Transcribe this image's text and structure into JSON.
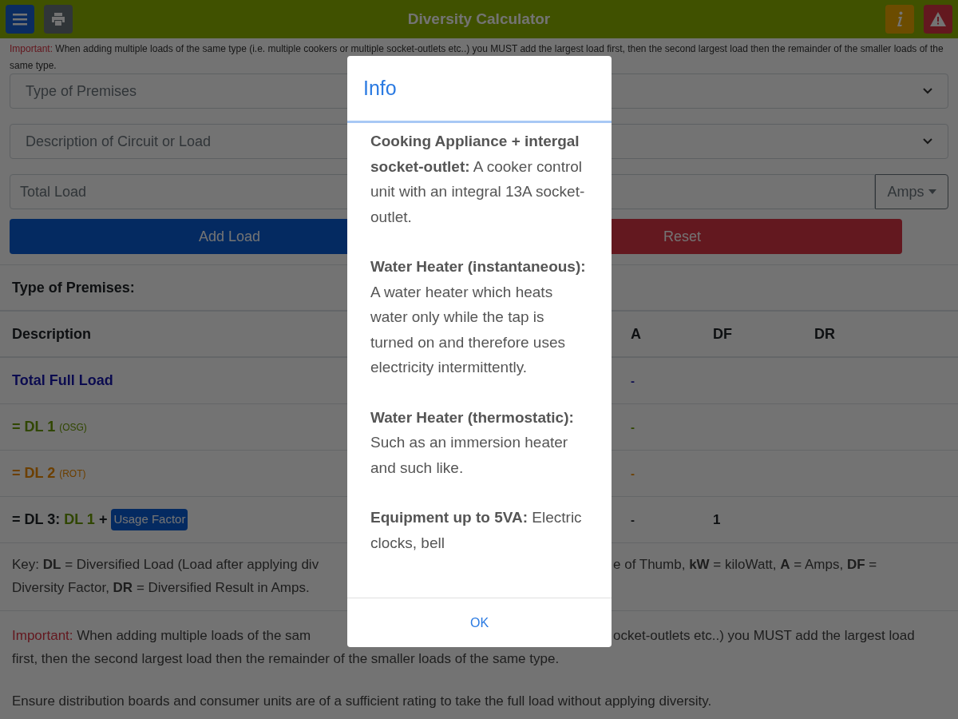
{
  "header": {
    "title": "Diversity Calculator"
  },
  "notice_top": {
    "label": "Important:",
    "text": "When adding multiple loads of the same type (i.e. multiple cookers or multiple socket-outlets etc..) you MUST add the largest load first, then the second largest load then the remainder of the smaller loads of the same type."
  },
  "form": {
    "premises_select": {
      "placeholder": "Type of Premises"
    },
    "load_select": {
      "placeholder": "Description of Circuit or Load"
    },
    "total_load": {
      "placeholder": "Total Load"
    },
    "unit_button": "Amps",
    "add_button": "Add Load",
    "reset_button": "Reset"
  },
  "summary": {
    "label": "Type of Premises:"
  },
  "table": {
    "columns": [
      "Description",
      "A",
      "DF",
      "DR"
    ],
    "rows": [
      {
        "kind": "total",
        "label": "Total Full Load",
        "a": "-"
      },
      {
        "kind": "dl1",
        "prefix": "=",
        "label": "DL 1",
        "note": "(OSG)",
        "a": "-"
      },
      {
        "kind": "dl2",
        "prefix": "=",
        "label": "DL 2",
        "note": "(ROT)",
        "a": "-"
      },
      {
        "kind": "dl3",
        "prefix": "=",
        "label": "DL 3:",
        "ref": "DL 1",
        "op": "+",
        "badge": "Usage Factor",
        "a": "-",
        "df": "1"
      }
    ]
  },
  "key": {
    "left": "Key: **DL** = Diversified Load (Load after applying div",
    "right": "e of Thumb, **kW** = kiloWatt, **A** = Amps, **DF** =",
    "line_2": "Diversity Factor, **DR** = Diversified Result in Amps."
  },
  "important": {
    "label": "Important:",
    "left": "When adding multiple loads of the sam",
    "right": "ocket-outlets etc..) you MUST add the largest load",
    "line_2": "first, then the second largest load then the remainder of the smaller loads of the same type."
  },
  "note": "Ensure distribution boards and consumer units are of a sufficient rating to take the full load without applying diversity.",
  "modal": {
    "title": "Info",
    "entries": [
      "**Cooking Appliance + intergal socket-outlet:** A cooker control unit with an integral 13A socket-outlet.",
      "**Water Heater (instantaneous):** A water heater which heats water only while the tap is turned on and therefore uses electricity intermittently.",
      "**Water Heater (thermostatic):** Such as an immersion heater and such like.",
      "**Equipment up to 5VA:** Electric clocks, bell"
    ],
    "ok": "OK"
  }
}
